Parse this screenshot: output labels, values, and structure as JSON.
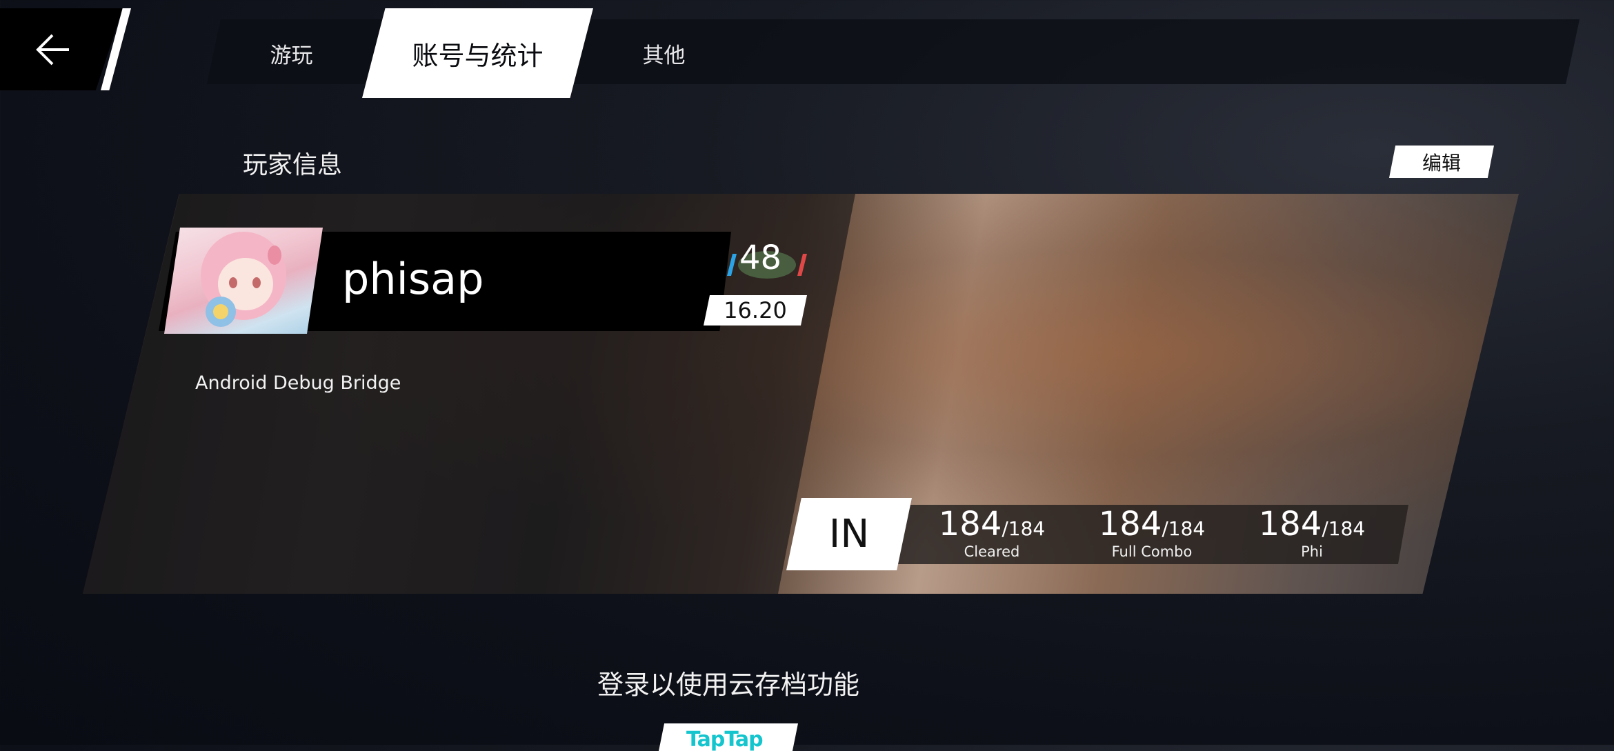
{
  "tabs": {
    "play": "游玩",
    "account": "账号与统计",
    "other": "其他"
  },
  "player_info": {
    "section_title": "玩家信息",
    "edit_label": "编辑",
    "name": "phisap",
    "level": "48",
    "rks": "16.20",
    "bio": "Android Debug Bridge"
  },
  "stats": {
    "difficulty": "IN",
    "cleared": {
      "value": "184",
      "total": "/184",
      "label": "Cleared"
    },
    "full_combo": {
      "value": "184",
      "total": "/184",
      "label": "Full Combo"
    },
    "phi": {
      "value": "184",
      "total": "/184",
      "label": "Phi"
    }
  },
  "cloud": {
    "title": "登录以使用云存档功能",
    "login_label": "TapTap"
  },
  "colors": {
    "taptap": "#15c5ce",
    "background": "#0e1019"
  },
  "icons": [
    "back-arrow-icon",
    "level-badge-icon"
  ]
}
